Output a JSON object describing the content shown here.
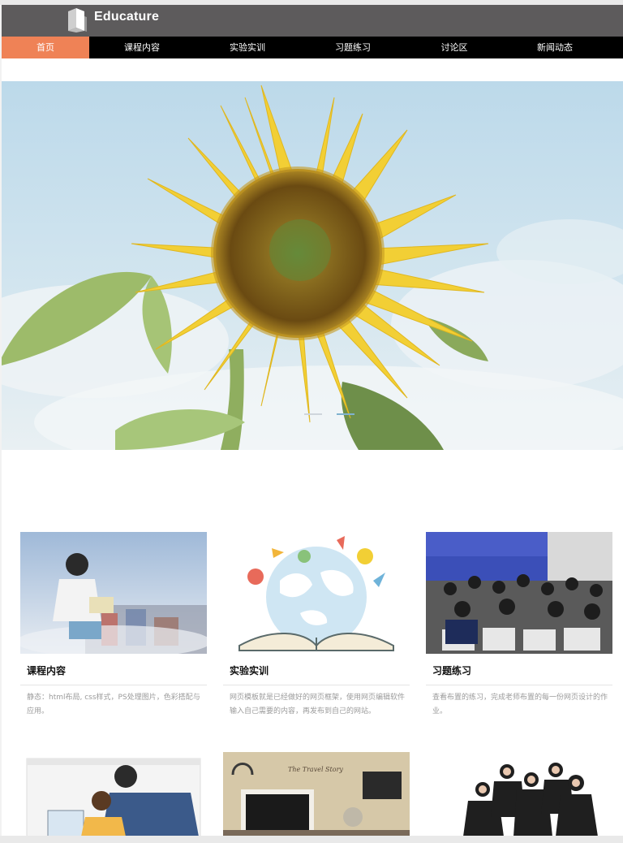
{
  "header": {
    "brand": "Educature",
    "logo_icon": "book-logo-icon",
    "background": "#5d5b5c"
  },
  "nav": {
    "items": [
      {
        "label": "首页",
        "active": true
      },
      {
        "label": "课程内容",
        "active": false
      },
      {
        "label": "实验实训",
        "active": false
      },
      {
        "label": "习题练习",
        "active": false
      },
      {
        "label": "讨论区",
        "active": false
      },
      {
        "label": "新闻动态",
        "active": false
      }
    ],
    "active_color": "#ef8256"
  },
  "hero": {
    "image": "sunflower-banner-image",
    "slides": 2,
    "active_slide": 2
  },
  "cards": [
    {
      "title": "课程内容",
      "desc": "静态：html布局, css样式，PS处理图片，色彩搭配与应用。",
      "image": "girl-reading-city-image"
    },
    {
      "title": "实验实训",
      "desc": "网页模板就是已经做好的网页框架，使用网页编辑软件输入自己需要的内容，再发布到自己的网站。",
      "image": "open-book-globe-image"
    },
    {
      "title": "习题练习",
      "desc": "查看布置的练习，完成老师布置的每一份网页设计的作业。",
      "image": "students-classroom-image"
    }
  ],
  "bottom_cards": [
    {
      "image": "tutor-student-laptop-image"
    },
    {
      "image": "travel-story-desk-image"
    },
    {
      "image": "group-of-friends-image"
    }
  ]
}
